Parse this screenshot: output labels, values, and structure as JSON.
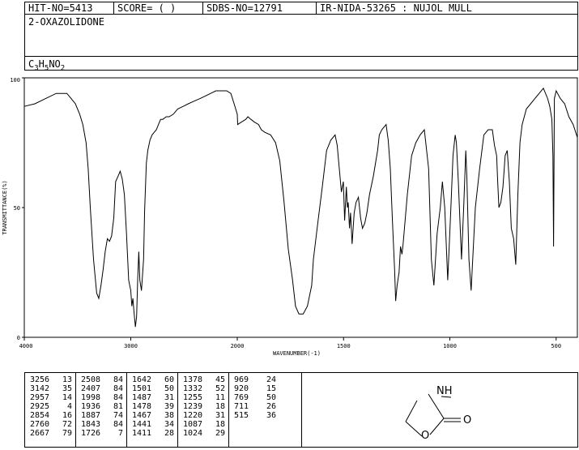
{
  "header": {
    "hit": "HIT-NO=5413",
    "score": "SCORE=  (   )",
    "sdbs": "SDBS-NO=12791",
    "ir": "IR-NIDA-53265 : NUJOL MULL"
  },
  "compound_name": "2-OXAZOLIDONE",
  "formula": {
    "c": "C",
    "c_n": "3",
    "h": "H",
    "h_n": "5",
    "rest": "NO",
    "o_n": "2"
  },
  "structure": {
    "nh": "NH",
    "o_ring": "O",
    "o_carbonyl": "O"
  },
  "peaks": [
    [
      [
        "3256",
        "13"
      ],
      [
        "3142",
        "35"
      ],
      [
        "2957",
        "14"
      ],
      [
        "2925",
        "4"
      ],
      [
        "2854",
        "16"
      ],
      [
        "2760",
        "72"
      ],
      [
        "2667",
        "79"
      ]
    ],
    [
      [
        "2508",
        "84"
      ],
      [
        "2407",
        "84"
      ],
      [
        "1998",
        "84"
      ],
      [
        "1936",
        "81"
      ],
      [
        "1887",
        "74"
      ],
      [
        "1843",
        "84"
      ],
      [
        "1726",
        "7"
      ]
    ],
    [
      [
        "1642",
        "60"
      ],
      [
        "1501",
        "50"
      ],
      [
        "1487",
        "31"
      ],
      [
        "1478",
        "39"
      ],
      [
        "1467",
        "38"
      ],
      [
        "1441",
        "34"
      ],
      [
        "1411",
        "28"
      ]
    ],
    [
      [
        "1378",
        "45"
      ],
      [
        "1332",
        "52"
      ],
      [
        "1255",
        "11"
      ],
      [
        "1239",
        "18"
      ],
      [
        "1220",
        "31"
      ],
      [
        "1087",
        "18"
      ],
      [
        "1024",
        "29"
      ]
    ],
    [
      [
        "969",
        "24"
      ],
      [
        "920",
        "15"
      ],
      [
        "769",
        "50"
      ],
      [
        "711",
        "26"
      ],
      [
        "515",
        "36"
      ]
    ]
  ],
  "chart_data": {
    "type": "line",
    "title": "",
    "xlabel": "WAVENUMBER(-1)",
    "ylabel": "TRANSMITTANCE(%)",
    "xlim": [
      4000,
      400
    ],
    "ylim": [
      0,
      100
    ],
    "xticks": [
      4000,
      3000,
      2000,
      1500,
      1000,
      500
    ],
    "yticks": [
      0,
      50,
      100
    ],
    "grid": false,
    "series": [
      {
        "x": [
          4000,
          3900,
          3800,
          3700,
          3600,
          3560,
          3520,
          3480,
          3450,
          3420,
          3400,
          3380,
          3350,
          3320,
          3300,
          3280,
          3260,
          3240,
          3220,
          3200,
          3180,
          3160,
          3142,
          3120,
          3100,
          3080,
          3060,
          3040,
          3020,
          3000,
          2990,
          2980,
          2970,
          2957,
          2945,
          2935,
          2925,
          2915,
          2900,
          2880,
          2870,
          2865,
          2860,
          2854,
          2840,
          2820,
          2800,
          2780,
          2760,
          2740,
          2720,
          2700,
          2667,
          2640,
          2600,
          2560,
          2508,
          2460,
          2407,
          2350,
          2300,
          2250,
          2200,
          2150,
          2100,
          2060,
          2030,
          2000,
          1998,
          1980,
          1960,
          1950,
          1936,
          1920,
          1900,
          1887,
          1870,
          1843,
          1820,
          1800,
          1780,
          1760,
          1740,
          1726,
          1710,
          1690,
          1670,
          1650,
          1642,
          1620,
          1600,
          1580,
          1560,
          1540,
          1530,
          1520,
          1510,
          1501,
          1495,
          1487,
          1482,
          1478,
          1472,
          1467,
          1460,
          1450,
          1441,
          1430,
          1420,
          1411,
          1400,
          1390,
          1378,
          1360,
          1340,
          1332,
          1320,
          1300,
          1290,
          1280,
          1270,
          1260,
          1255,
          1248,
          1239,
          1232,
          1225,
          1220,
          1200,
          1180,
          1160,
          1140,
          1120,
          1100,
          1087,
          1075,
          1060,
          1045,
          1035,
          1024,
          1010,
          995,
          985,
          975,
          969,
          960,
          945,
          935,
          925,
          920,
          910,
          900,
          880,
          860,
          840,
          820,
          800,
          790,
          780,
          775,
          769,
          760,
          750,
          740,
          730,
          720,
          711,
          700,
          690,
          680,
          670,
          660,
          650,
          640,
          620,
          600,
          580,
          560,
          540,
          530,
          520,
          515,
          512,
          508,
          500,
          480,
          460,
          440,
          420,
          400
        ],
        "y": [
          89,
          90,
          92,
          94,
          94,
          92,
          90,
          86,
          82,
          75,
          65,
          50,
          30,
          17,
          15,
          20,
          26,
          33,
          38,
          37,
          39,
          46,
          60,
          62,
          64,
          61,
          55,
          40,
          22,
          18,
          12,
          15,
          10,
          4,
          8,
          22,
          33,
          22,
          18,
          30,
          49,
          55,
          60,
          67,
          72,
          76,
          78,
          79,
          80,
          82,
          84,
          84,
          85,
          85,
          86,
          88,
          89,
          90,
          91,
          92,
          93,
          94,
          95,
          95,
          95,
          94,
          90,
          86,
          82,
          83,
          84,
          85,
          84,
          83,
          82,
          80,
          79,
          78,
          75,
          68,
          52,
          34,
          22,
          12,
          9,
          9,
          12,
          20,
          30,
          45,
          58,
          72,
          76,
          78,
          74,
          65,
          56,
          60,
          45,
          58,
          50,
          52,
          42,
          48,
          36,
          48,
          52,
          54,
          46,
          42,
          44,
          48,
          55,
          62,
          72,
          78,
          80,
          82,
          76,
          65,
          45,
          26,
          14,
          20,
          25,
          35,
          32,
          36,
          55,
          70,
          75,
          78,
          80,
          65,
          30,
          20,
          40,
          50,
          60,
          50,
          22,
          50,
          70,
          78,
          75,
          60,
          30,
          50,
          72,
          62,
          30,
          18,
          50,
          65,
          78,
          80,
          80,
          74,
          70,
          60,
          50,
          52,
          58,
          70,
          72,
          60,
          42,
          38,
          28,
          55,
          75,
          82,
          85,
          88,
          90,
          92,
          94,
          96,
          92,
          89,
          84,
          70,
          35,
          92,
          95,
          92,
          90,
          85,
          82,
          77
        ]
      }
    ]
  }
}
